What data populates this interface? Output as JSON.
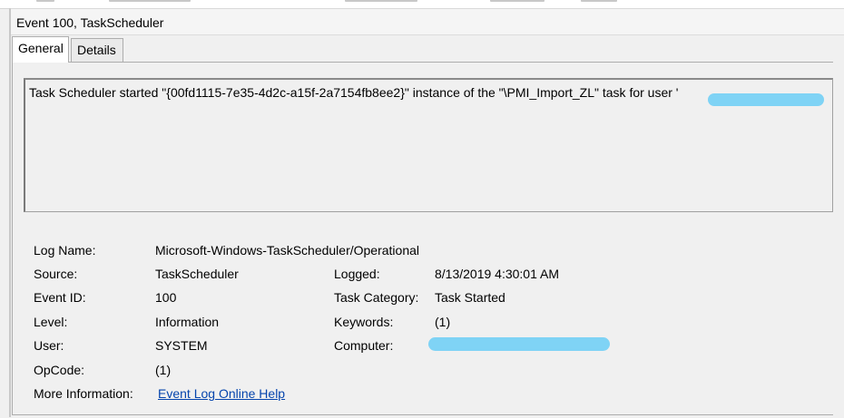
{
  "window": {
    "title": "Event 100, TaskScheduler"
  },
  "tabs": [
    {
      "label": "General",
      "active": true
    },
    {
      "label": "Details",
      "active": false
    }
  ],
  "description": "Task Scheduler started \"{00fd1115-7e35-4d2c-a15f-2a7154fb8ee2}\" instance of the \"\\PMI_Import_ZL\" task for user '",
  "fields": {
    "log_name": {
      "label": "Log Name:",
      "value": "Microsoft-Windows-TaskScheduler/Operational"
    },
    "source": {
      "label": "Source:",
      "value": "TaskScheduler"
    },
    "logged": {
      "label": "Logged:",
      "value": "8/13/2019 4:30:01 AM"
    },
    "event_id": {
      "label": "Event ID:",
      "value": "100"
    },
    "task_category": {
      "label": "Task Category:",
      "value": "Task Started"
    },
    "level": {
      "label": "Level:",
      "value": "Information"
    },
    "keywords": {
      "label": "Keywords:",
      "value": "(1)"
    },
    "user": {
      "label": "User:",
      "value": "SYSTEM"
    },
    "computer": {
      "label": "Computer:",
      "value": ""
    },
    "opcode": {
      "label": "OpCode:",
      "value": "(1)"
    },
    "more_info": {
      "label": "More Information:",
      "link": "Event Log Online Help"
    }
  },
  "colors": {
    "redaction": "#7fd3f5",
    "link": "#0645ad"
  }
}
